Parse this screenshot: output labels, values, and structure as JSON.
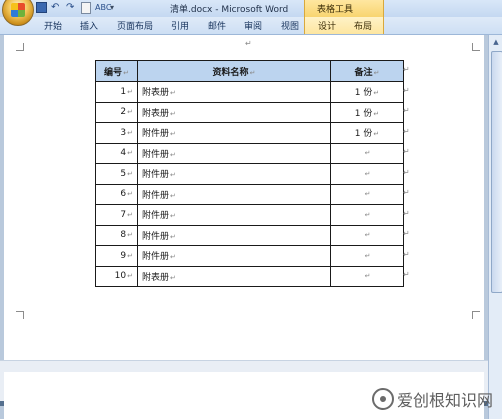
{
  "window": {
    "title": "清单.docx - Microsoft Word",
    "context_tab_group": "表格工具"
  },
  "quick_access": {
    "icons": [
      "save-icon",
      "undo-icon",
      "redo-icon",
      "print-preview-icon",
      "spelling-icon",
      "customize-icon"
    ]
  },
  "ribbon": {
    "tabs": [
      {
        "label": "开始"
      },
      {
        "label": "插入"
      },
      {
        "label": "页面布局"
      },
      {
        "label": "引用"
      },
      {
        "label": "邮件"
      },
      {
        "label": "审阅"
      },
      {
        "label": "视图"
      },
      {
        "label": "设计"
      },
      {
        "label": "布局"
      }
    ]
  },
  "document": {
    "paragraph_mark": "↵",
    "cell_mark": "↵",
    "table": {
      "headers": [
        "编号",
        "资料名称",
        "备注"
      ],
      "rows": [
        {
          "num": "1",
          "name": "附表册",
          "note": "1 份"
        },
        {
          "num": "2",
          "name": "附表册",
          "note": "1 份"
        },
        {
          "num": "3",
          "name": "附件册",
          "note": "1 份"
        },
        {
          "num": "4",
          "name": "附件册",
          "note": ""
        },
        {
          "num": "5",
          "name": "附件册",
          "note": ""
        },
        {
          "num": "6",
          "name": "附件册",
          "note": ""
        },
        {
          "num": "7",
          "name": "附件册",
          "note": ""
        },
        {
          "num": "8",
          "name": "附件册",
          "note": ""
        },
        {
          "num": "9",
          "name": "附件册",
          "note": ""
        },
        {
          "num": "10",
          "name": "附表册",
          "note": ""
        }
      ]
    }
  },
  "watermark": {
    "text": "爱创根知识网"
  },
  "colors": {
    "header_fill": "#bcd4ef",
    "context_tab": "#fde6a0",
    "ribbon": "#cddff4"
  }
}
